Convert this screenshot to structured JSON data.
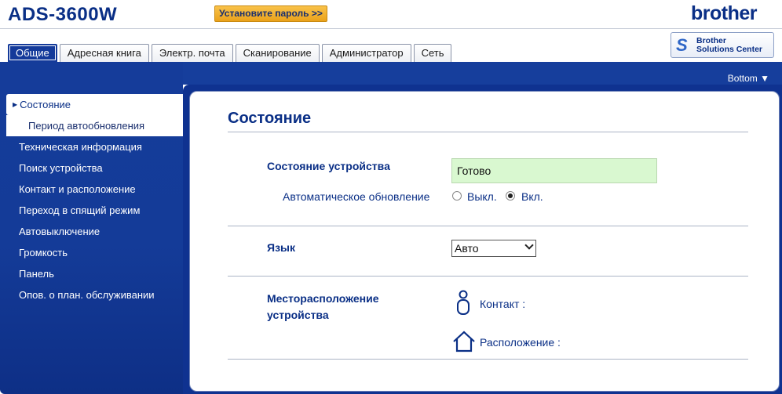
{
  "header": {
    "model": "ADS-3600W",
    "set_password": "Установите пароль >>",
    "logo": "brother",
    "solutions_center": {
      "icon": "S",
      "line1": "Brother",
      "line2": "Solutions Center"
    }
  },
  "tabs": [
    {
      "label": "Общие",
      "active": true
    },
    {
      "label": "Адресная книга",
      "active": false
    },
    {
      "label": "Электр. почта",
      "active": false
    },
    {
      "label": "Сканирование",
      "active": false
    },
    {
      "label": "Администратор",
      "active": false
    },
    {
      "label": "Сеть",
      "active": false
    }
  ],
  "bottom_link": "Bottom ▼",
  "sidebar": {
    "active": "Состояние",
    "sub": "Период автообновления",
    "items": [
      "Техническая информация",
      "Поиск устройства",
      "Контакт и расположение",
      "Переход в спящий режим",
      "Автовыключение",
      "Громкость",
      "Панель",
      "Опов. о план. обслуживании"
    ]
  },
  "main": {
    "title": "Состояние",
    "device_status_label": "Состояние устройства",
    "device_status_value": "Готово",
    "auto_refresh_label": "Автоматическое обновление",
    "auto_refresh_off": "Выкл.",
    "auto_refresh_on": "Вкл.",
    "auto_refresh_selected": "on",
    "language_label": "Язык",
    "language_value": "Авто",
    "location_label_line1": "Месторасположение",
    "location_label_line2": "устройства",
    "contact_label": "Контакт :",
    "location_label": "Расположение :"
  },
  "colors": {
    "brand_blue": "#0a2f86",
    "nav_blue": "#163e9c",
    "status_green": "#d9f8d0",
    "button_orange": "#f9c24a"
  }
}
